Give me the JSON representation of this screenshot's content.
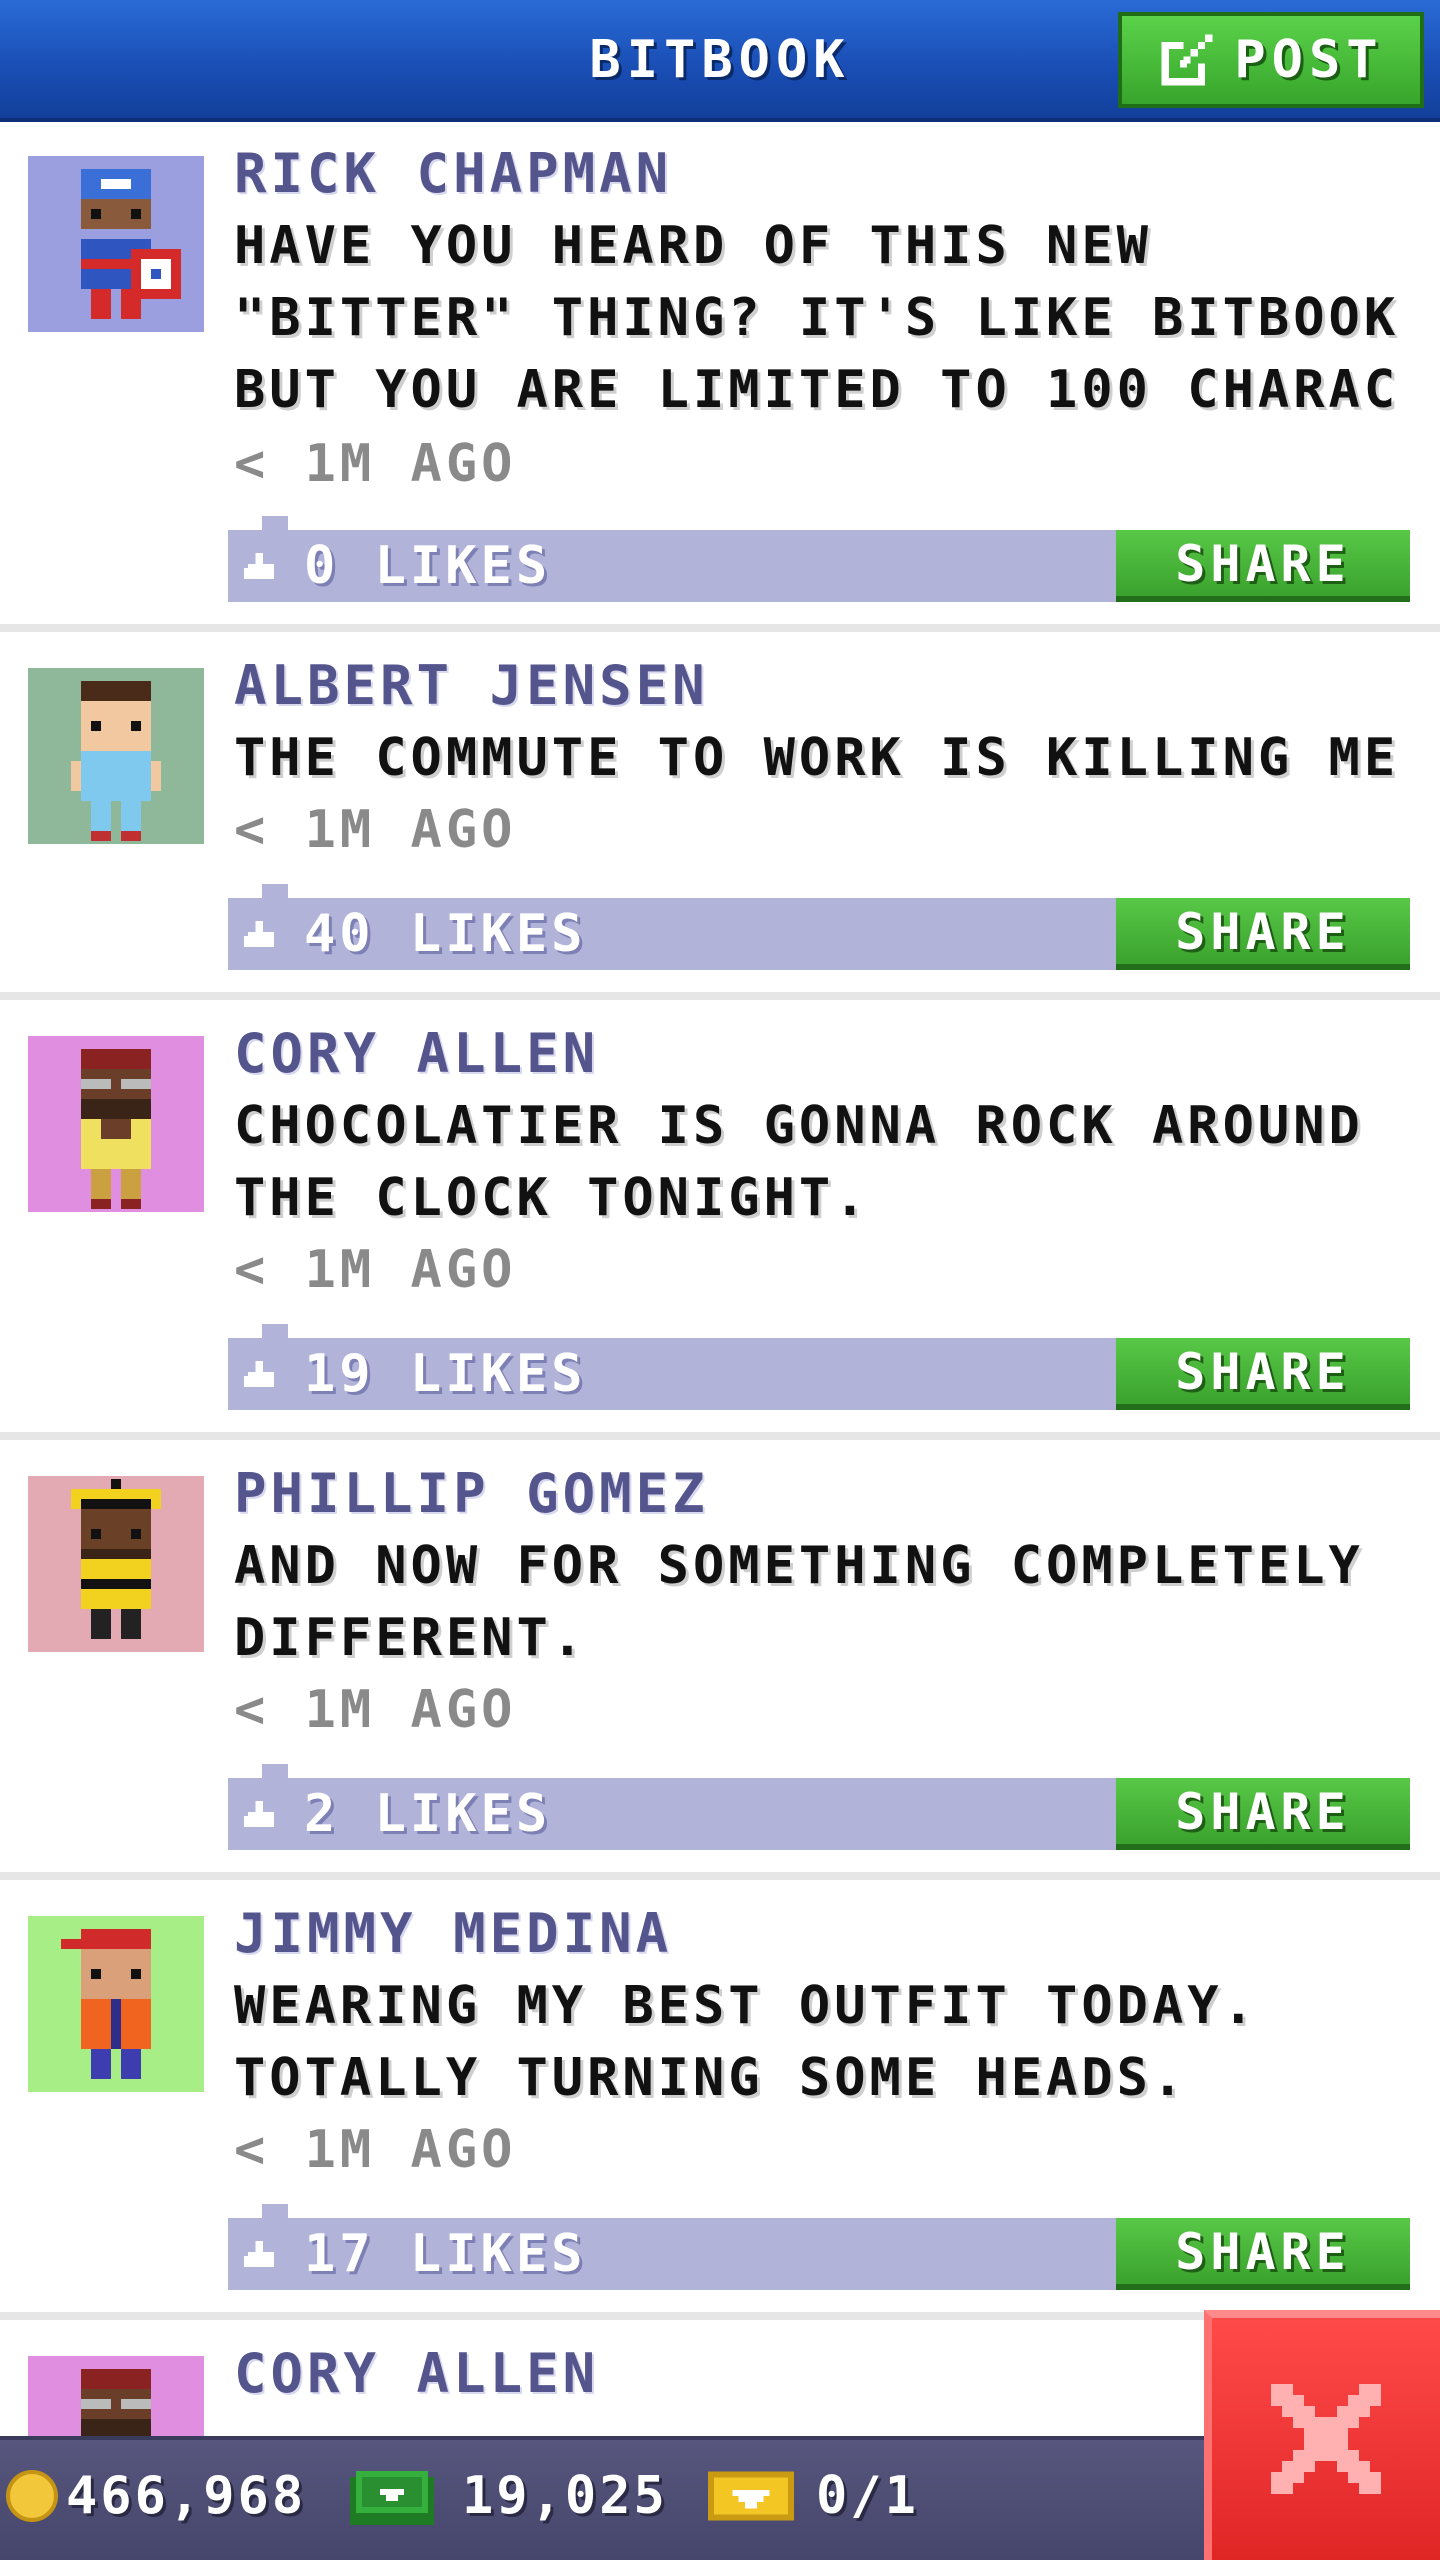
{
  "header": {
    "title": "BITBOOK",
    "post_label": "POST"
  },
  "colors": {
    "header_blue": "#1a4fb6",
    "post_green": "#3aa22d",
    "like_bar": "#b1b3d9",
    "author_purple": "#55558e",
    "footer": "#4d4d75",
    "close_red": "#e02525"
  },
  "posts": [
    {
      "author": "RICK CHAPMAN",
      "message": "HAVE YOU HEARD OF THIS NEW \"BITTER\" THING? IT'S LIKE BITBOOK BUT YOU ARE LIMITED TO 100 CHARAC",
      "time": "< 1M AGO",
      "likes": "0 LIKES",
      "share_label": "SHARE",
      "avatar_icon": "superhero-avatar",
      "avatar_bg": "#9b9fdf"
    },
    {
      "author": "ALBERT JENSEN",
      "message": "THE COMMUTE TO WORK IS KILLING ME :(",
      "time": "< 1M AGO",
      "likes": "40 LIKES",
      "share_label": "SHARE",
      "avatar_icon": "boy-avatar",
      "avatar_bg": "#8fb89a"
    },
    {
      "author": "CORY ALLEN",
      "message": "CHOCOLATIER IS GONNA ROCK AROUND THE CLOCK TONIGHT.",
      "time": "< 1M AGO",
      "likes": "19 LIKES",
      "share_label": "SHARE",
      "avatar_icon": "bearded-man-avatar",
      "avatar_bg": "#e08ee0"
    },
    {
      "author": "PHILLIP GOMEZ",
      "message": "AND NOW FOR SOMETHING COMPLETELY DIFFERENT.",
      "time": "< 1M AGO",
      "likes": "2 LIKES",
      "share_label": "SHARE",
      "avatar_icon": "hardhat-worker-avatar",
      "avatar_bg": "#e4aab4"
    },
    {
      "author": "JIMMY MEDINA",
      "message": "WEARING MY BEST OUTFIT TODAY. TOTALLY TURNING SOME HEADS.",
      "time": "< 1M AGO",
      "likes": "17 LIKES",
      "share_label": "SHARE",
      "avatar_icon": "red-cap-avatar",
      "avatar_bg": "#a8ee86"
    },
    {
      "author": "CORY ALLEN",
      "avatar_icon": "bearded-man-avatar",
      "avatar_bg": "#e08ee0"
    }
  ],
  "footer": {
    "coins": "466,968",
    "bux": "19,025",
    "tickets": "0/1"
  }
}
